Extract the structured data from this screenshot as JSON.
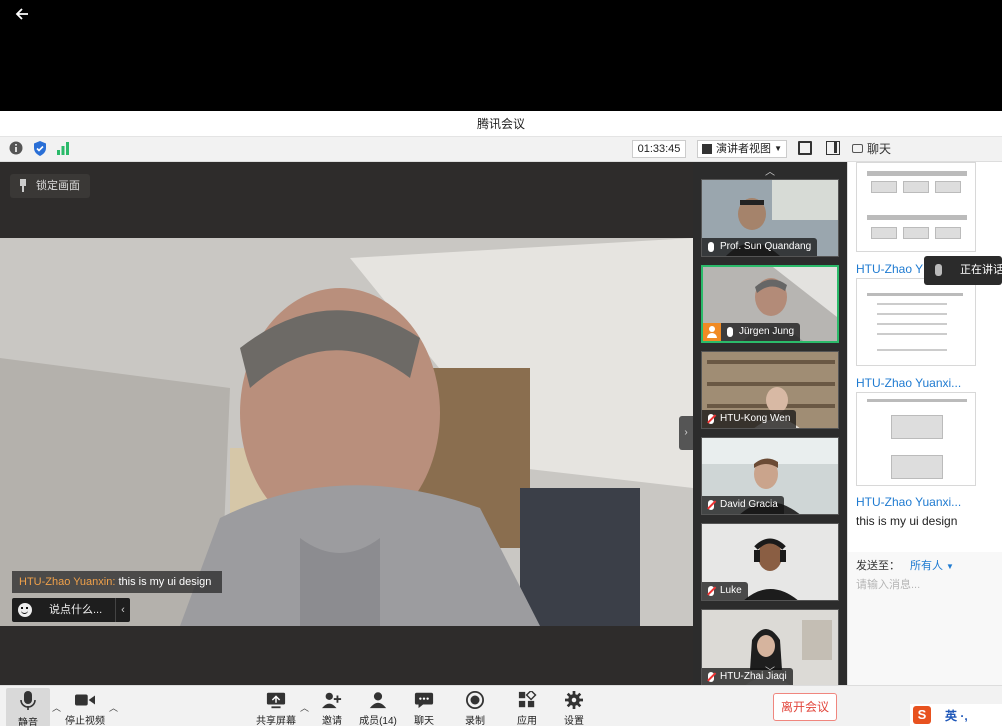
{
  "window": {
    "title": "腾讯会议"
  },
  "toolbar": {
    "timer": "01:33:45",
    "view_mode": "演讲者视图"
  },
  "chat_panel": {
    "header": "聊天",
    "messages": [
      {
        "sender": "HTU-Zhao Y",
        "type": "image"
      },
      {
        "sender": "HTU-Zhao Yuanxi...",
        "type": "image"
      },
      {
        "sender": "HTU-Zhao Yuanxi...",
        "text": "this is my ui design"
      }
    ],
    "speaking_label": "正在讲话:",
    "send_to_label": "发送至：",
    "send_to_target": "所有人",
    "input_placeholder": "请输入消息..."
  },
  "stage": {
    "lock_label": "锁定画面",
    "overlay_sender": "HTU-Zhao Yuanxin:",
    "overlay_text": " this is my ui design",
    "say_placeholder": "说点什么..."
  },
  "participants": [
    {
      "name": "Prof. Sun Quandang",
      "muted": false,
      "active": false,
      "host": false
    },
    {
      "name": "Jürgen Jung",
      "muted": false,
      "active": true,
      "host": true
    },
    {
      "name": "HTU-Kong Wen",
      "muted": true,
      "active": false,
      "host": false
    },
    {
      "name": "David Gracia",
      "muted": true,
      "active": false,
      "host": false
    },
    {
      "name": "Luke",
      "muted": true,
      "active": false,
      "host": false
    },
    {
      "name": "HTU-Zhai Jiaqi",
      "muted": true,
      "active": false,
      "host": false
    }
  ],
  "bottom_bar": {
    "mic_label": "静音",
    "video_label": "停止视频",
    "share_label": "共享屏幕",
    "invite_label": "邀请",
    "members_label": "成员(14)",
    "chat_label": "聊天",
    "record_label": "录制",
    "apps_label": "应用",
    "settings_label": "设置",
    "leave_label": "离开会议"
  },
  "tray": {
    "ime": "S",
    "text": "英 ·,"
  },
  "colors": {
    "active_border": "#2bba6a",
    "leave": "#e2463c",
    "link": "#1f7bd1",
    "sender_orange": "#f0a14a"
  }
}
